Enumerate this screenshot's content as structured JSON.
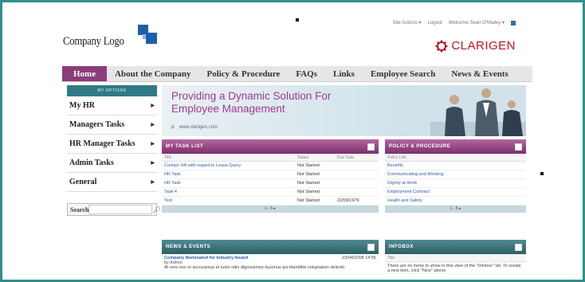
{
  "header": {
    "logo_text": "Company Logo",
    "user_links": [
      "Site Actions ▾",
      "Logout",
      "Welcome Sean O'Malley ▾"
    ],
    "brand_name": "CLARIGEN",
    "brand_color": "#c1121f"
  },
  "nav": {
    "items": [
      "Home",
      "About the Company",
      "Policy & Procedure",
      "FAQs",
      "Links",
      "Employee Search",
      "News & Events"
    ],
    "active": "Home"
  },
  "sidebar": {
    "heading": "MY OPTIONS",
    "items": [
      "My HR",
      "Managers Tasks",
      "HR Manager Tasks",
      "Admin Tasks",
      "General"
    ],
    "search_label": "Search"
  },
  "banner": {
    "title_line1": "Providing a Dynamic Solution For",
    "title_line2": "Employee Management",
    "url": "www.clarigen.com"
  },
  "tasklist": {
    "heading": "MY TASK LIST",
    "columns": [
      "Title",
      "Status",
      "Due Date"
    ],
    "rows": [
      [
        "Contact HR with regard to Leave Query",
        "Not Started",
        ""
      ],
      [
        "HR Task",
        "Not Started",
        ""
      ],
      [
        "HR Task",
        "Not Started",
        ""
      ],
      [
        "Task 4",
        "Not Started",
        ""
      ],
      [
        "Test",
        "Not Started",
        "22/09/1979"
      ]
    ],
    "pager": "1 - 5 ▸"
  },
  "policy": {
    "heading": "POLICY & PROCEDURE",
    "column": "Policy Link",
    "rows": [
      "Benefits",
      "Communicating and Working",
      "Dignity at Work",
      "Employment Contract",
      "Health and Safety"
    ],
    "pager": "1 - 5 ▸"
  },
  "news": {
    "heading": "NEWS & EVENTS",
    "title": "Company Nominated for Industry Award",
    "date": "23/04/2008 14:55",
    "by": "by Admin",
    "text": "At vero eos et accusamus et iusto odio dignissimos ducimus qui blanditiis voluptatum deleniti"
  },
  "infobox": {
    "heading": "INFOBOX",
    "column": "Title",
    "text": "There are no items to show in this view of the \"Infobox\" list. To create a new item, click \"New\" above."
  },
  "colors": {
    "primary_purple": "#8a3d7a",
    "teal": "#2f7a86",
    "frame": "#2f8f8c"
  }
}
